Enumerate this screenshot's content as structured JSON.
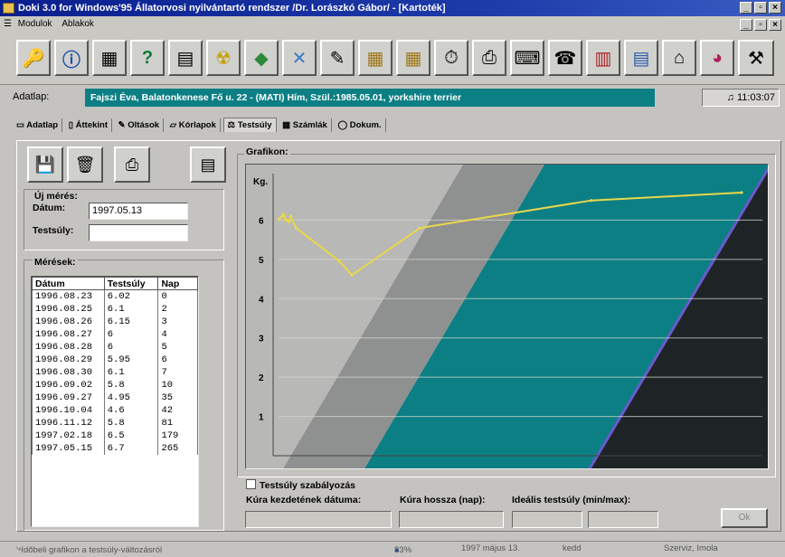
{
  "window": {
    "title": "Doki 3.0 for Windows'95 Állatorvosi nyilvántartó rendszer /Dr. Lorászkó Gábor/  - [Kartoték]",
    "minimize": "_",
    "restore": "×",
    "close": "×"
  },
  "menu": {
    "items": [
      "Modulok",
      "Ablakok"
    ]
  },
  "toolbar": {
    "icons": [
      "key-icon",
      "info-icon",
      "calculator-icon",
      "help-icon",
      "documents-icon",
      "radiation-icon",
      "map-icon",
      "chart-icon",
      "syringe-icon",
      "grid-icon",
      "table-icon",
      "stopwatch-icon",
      "printer-icon",
      "typewriter-icon",
      "phone-icon",
      "books-icon",
      "notes-icon",
      "house-icon",
      "pie-icon",
      "tools-icon"
    ]
  },
  "adatlap": {
    "label": "Adatlap:",
    "value": "Fajszi Éva, Balatonkenese Fő u. 22 - (MATI) Hím, Szül.:1985.05.01, yorkshire terrier",
    "time": "11:03:07"
  },
  "tabs": [
    {
      "label": "Adatlap"
    },
    {
      "label": "Áttekint"
    },
    {
      "label": "Oltások"
    },
    {
      "label": "Kórlapok"
    },
    {
      "label": "Testsúly",
      "active": true
    },
    {
      "label": "Számlák"
    },
    {
      "label": "Dokum."
    }
  ],
  "new_measure": {
    "title": "Új mérés:",
    "date_label": "Dátum:",
    "date_value": "1997.05.13",
    "weight_label": "Testsúly:",
    "weight_value": ""
  },
  "measures": {
    "title": "Mérések:",
    "headers": [
      "Dátum",
      "Testsúly",
      "Nap"
    ],
    "rows": [
      [
        "1996.08.23",
        "6.02",
        "0"
      ],
      [
        "1996.08.25",
        "6.1",
        "2"
      ],
      [
        "1996.08.26",
        "6.15",
        "3"
      ],
      [
        "1996.08.27",
        "6",
        "4"
      ],
      [
        "1996.08.28",
        "6",
        "5"
      ],
      [
        "1996.08.29",
        "5.95",
        "6"
      ],
      [
        "1996.08.30",
        "6.1",
        "7"
      ],
      [
        "1996.09.02",
        "5.8",
        "10"
      ],
      [
        "1996.09.27",
        "4.95",
        "35"
      ],
      [
        "1996.10.04",
        "4.6",
        "42"
      ],
      [
        "1996.11.12",
        "5.8",
        "81"
      ],
      [
        "1997.02.18",
        "6.5",
        "179"
      ],
      [
        "1997.05.15",
        "6.7",
        "265"
      ]
    ]
  },
  "graph": {
    "title": "Grafikon:",
    "ylabel": "Kg.",
    "yticks": [
      "6",
      "5",
      "4",
      "3",
      "2",
      "1"
    ]
  },
  "chart_data": {
    "type": "line",
    "ylabel": "Kg.",
    "ylim": [
      0,
      7
    ],
    "x": [
      0,
      2,
      3,
      4,
      5,
      6,
      7,
      10,
      35,
      42,
      81,
      179,
      265
    ],
    "series": [
      {
        "values": [
          6.02,
          6.1,
          6.15,
          6,
          6,
          5.95,
          6.1,
          5.8,
          4.95,
          4.6,
          5.8,
          6.5,
          6.7
        ]
      }
    ],
    "color": "#e8d84a"
  },
  "regulation": {
    "checkbox_label": "Testsúly szabályozás",
    "start_label": "Kúra kezdetének dátuma:",
    "length_label": "Kúra hossza (nap):",
    "ideal_label": "Ideális testsúly (min/max):",
    "ok_label": "Ok"
  },
  "status": {
    "hint": "Időbeli grafikon a testsúly-változásról",
    "percent": "83%",
    "date": "1997 május 13.",
    "day": "kedd",
    "place": "Szerviz, Imola"
  }
}
